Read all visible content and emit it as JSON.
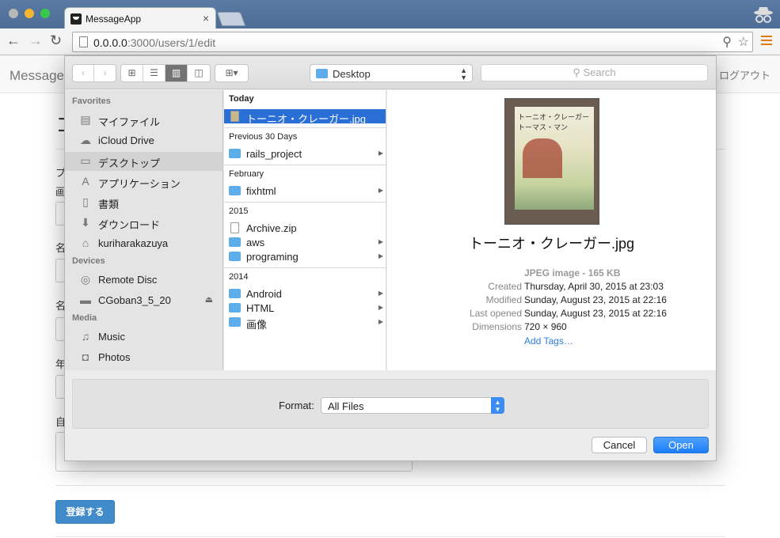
{
  "browser": {
    "tab_title": "MessageApp",
    "tab_close": "×",
    "url_host": "0.0.0.0",
    "url_rest": ":3000/users/1/edit"
  },
  "page": {
    "brand": "Message-",
    "logout": "ログアウト",
    "title": "コ",
    "labels": [
      "プ",
      "画",
      "名",
      "名",
      "年",
      "自"
    ],
    "submit": "登録する"
  },
  "dialog": {
    "location": "Desktop",
    "search_placeholder": "Search",
    "sidebar": {
      "sections": [
        {
          "title": "Favorites",
          "items": [
            {
              "label": "マイファイル",
              "icon": "all-files-icon"
            },
            {
              "label": "iCloud Drive",
              "icon": "cloud-icon"
            },
            {
              "label": "デスクトップ",
              "icon": "desktop-icon",
              "selected": true
            },
            {
              "label": "アプリケーション",
              "icon": "applications-icon"
            },
            {
              "label": "書類",
              "icon": "documents-icon"
            },
            {
              "label": "ダウンロード",
              "icon": "downloads-icon"
            },
            {
              "label": "kuriharakazuya",
              "icon": "home-icon"
            }
          ]
        },
        {
          "title": "Devices",
          "items": [
            {
              "label": "Remote Disc",
              "icon": "disc-icon"
            },
            {
              "label": "CGoban3_5_20",
              "icon": "drive-icon",
              "eject": "⏏"
            }
          ]
        },
        {
          "title": "Media",
          "items": [
            {
              "label": "Music",
              "icon": "music-icon"
            },
            {
              "label": "Photos",
              "icon": "camera-icon"
            }
          ]
        }
      ]
    },
    "column": {
      "groups": [
        {
          "header": "Today",
          "items": [
            {
              "label": "トーニオ・クレーガー.jpg",
              "type": "image",
              "selected": true
            }
          ]
        },
        {
          "header": "Previous 30 Days",
          "items": [
            {
              "label": "rails_project",
              "type": "folder"
            }
          ]
        },
        {
          "header": "February",
          "items": [
            {
              "label": "fixhtml",
              "type": "folder"
            }
          ]
        },
        {
          "header": "2015",
          "items": [
            {
              "label": "Archive.zip",
              "type": "file"
            },
            {
              "label": "aws",
              "type": "folder"
            },
            {
              "label": "programing",
              "type": "folder"
            }
          ]
        },
        {
          "header": "2014",
          "items": [
            {
              "label": "Android",
              "type": "folder"
            },
            {
              "label": "HTML",
              "type": "folder"
            },
            {
              "label": "画像",
              "type": "folder"
            }
          ]
        }
      ]
    },
    "preview": {
      "thumb_title": "トーニオ・クレーガー",
      "thumb_author": "トーマス・マン",
      "filename": "トーニオ・クレーガー.jpg",
      "kind": "JPEG image - 165 KB",
      "meta": [
        {
          "key": "Created",
          "value": "Thursday, April 30, 2015 at 23:03"
        },
        {
          "key": "Modified",
          "value": "Sunday, August 23, 2015 at 22:16"
        },
        {
          "key": "Last opened",
          "value": "Sunday, August 23, 2015 at 22:16"
        },
        {
          "key": "Dimensions",
          "value": "720 × 960"
        }
      ],
      "add_tags": "Add Tags…"
    },
    "format_label": "Format:",
    "format_value": "All Files",
    "cancel": "Cancel",
    "open": "Open"
  },
  "colors": {
    "accent": "#2a6fd6",
    "button": "#428bca"
  }
}
